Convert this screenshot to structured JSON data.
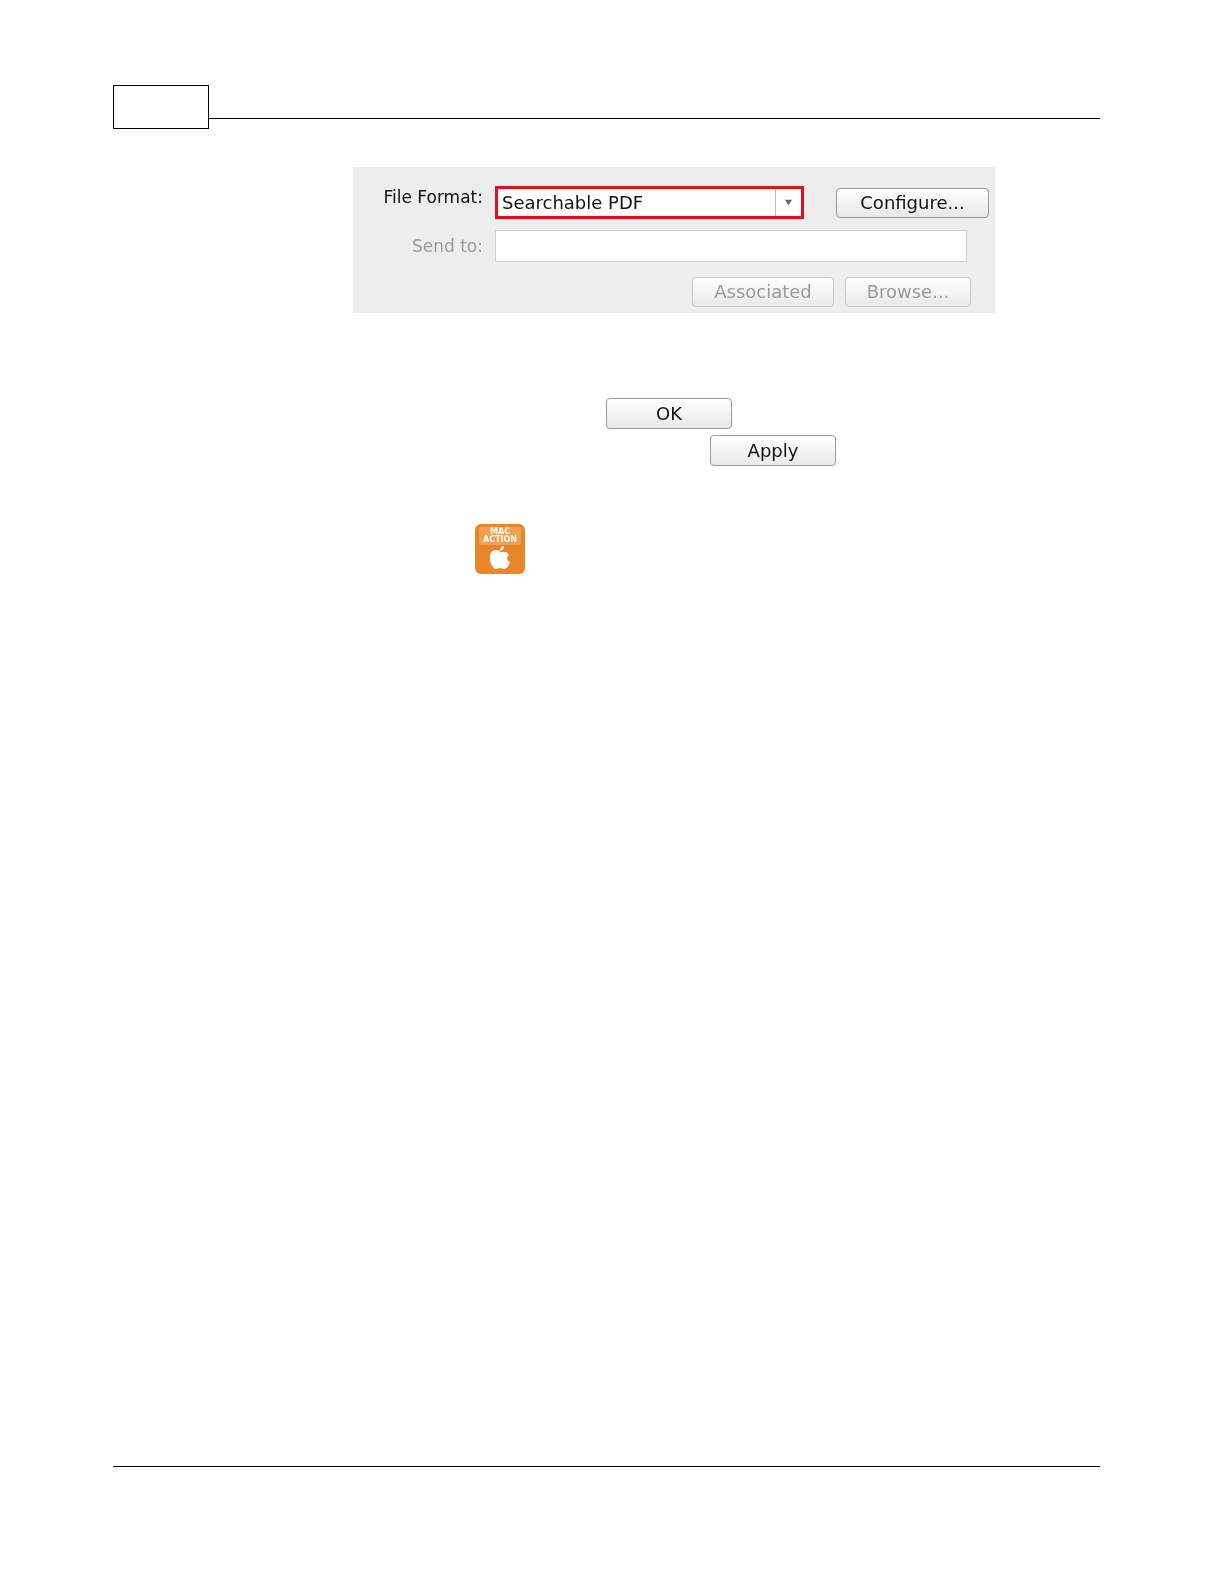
{
  "dialog": {
    "file_format": {
      "label": "File Format:",
      "value": "Searchable PDF",
      "highlighted": true,
      "button": "Configure..."
    },
    "send_to": {
      "label": "Send to:",
      "disabled": true
    },
    "buttons": [
      {
        "label": "Associated",
        "disabled": true
      },
      {
        "label": "Browse...",
        "disabled": true
      }
    ]
  },
  "page_buttons": [
    {
      "label": "OK"
    },
    {
      "label": "Apply"
    }
  ],
  "badge": {
    "lines": [
      "MAC",
      "ACTION"
    ]
  }
}
